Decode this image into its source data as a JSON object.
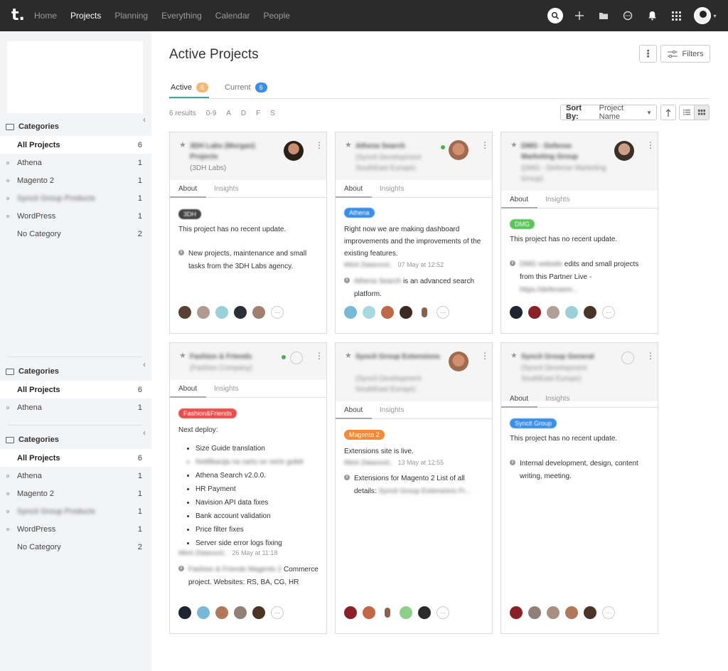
{
  "nav": {
    "logo": "t.",
    "items": [
      "Home",
      "Projects",
      "Planning",
      "Everything",
      "Calendar",
      "People"
    ],
    "active_index": 1
  },
  "sidebar": {
    "groups": [
      {
        "title": "Categories",
        "items": [
          {
            "label": "All Projects",
            "count": "6",
            "active": true
          },
          {
            "label": "Athena",
            "count": "1"
          },
          {
            "label": "Magento 2",
            "count": "1"
          },
          {
            "label": "Syncit Group Products",
            "count": "1",
            "blurred": true
          },
          {
            "label": "WordPress",
            "count": "1"
          },
          {
            "label": "No Category",
            "count": "2"
          }
        ]
      },
      {
        "title": "Categories",
        "items": [
          {
            "label": "All Projects",
            "count": "6",
            "active": true
          },
          {
            "label": "Athena",
            "count": "1"
          }
        ]
      },
      {
        "title": "Categories",
        "items": [
          {
            "label": "All Projects",
            "count": "6",
            "active": true
          },
          {
            "label": "Athena",
            "count": "1"
          },
          {
            "label": "Magento 2",
            "count": "1"
          },
          {
            "label": "Syncit Group Products",
            "count": "1",
            "blurred": true
          },
          {
            "label": "WordPress",
            "count": "1"
          },
          {
            "label": "No Category",
            "count": "2"
          }
        ]
      }
    ]
  },
  "header": {
    "title": "Active Projects",
    "filters_label": "Filters",
    "tabs": [
      {
        "label": "Active",
        "count": "6",
        "color": "#f5b87a"
      },
      {
        "label": "Current",
        "count": "6",
        "color": "#3a8ee6"
      }
    ],
    "results": "6 results",
    "letters": [
      "0-9",
      "A",
      "D",
      "F",
      "S"
    ],
    "sort_label": "Sort By:",
    "sort_value": "Project Name"
  },
  "cards": {
    "c1": {
      "title": "3DH Labs (Morgan) Projects",
      "subtitle": "(3DH Labs)",
      "tab_about": "About",
      "tab_insights": "Insights",
      "tag": "3DH",
      "tag_color": "#444444",
      "update": "This project has no recent update.",
      "info": "New projects, maintenance and small tasks from the 3DH Labs agency."
    },
    "c2": {
      "title": "Athena Search",
      "subtitle": "(Syncit Development SouthEast Europe)",
      "tab_about": "About",
      "tab_insights": "Insights",
      "tag": "Athena",
      "tag_color": "#3a8ee6",
      "update": "Right now we are making dashboard improvements and the improvements of the existing features.",
      "meta_author": "Miloš Zlatanović,",
      "meta_date": "07 May at 12:52",
      "info_blur": "Athena Search",
      "info": "is an advanced search platform."
    },
    "c3": {
      "title": "DMG - Defense Marketing Group",
      "subtitle": "(DMG - Defense Marketing Group)",
      "tab_about": "About",
      "tab_insights": "Insights",
      "tag": "DMG",
      "tag_color": "#5cc45c",
      "update": "This project has no recent update.",
      "info_blur": "DMG website",
      "info": "edits and small projects from this Partner Live -",
      "info_tail": "https://defensem..."
    },
    "c4": {
      "title": "Fashion & Friends",
      "subtitle": "(Fashion Company)",
      "tab_about": "About",
      "tab_insights": "Insights",
      "tag": "Fashion&Friends",
      "tag_color": "#e84c4c",
      "update": "Next deploy:",
      "list": [
        "Size Guide translation",
        "Notifikacija na cartu se neće gubiti",
        "Athena Search v2.0.0.",
        "HR Payment",
        "Navision API data fixes",
        "Bank account validation",
        "Price filter fixes",
        "Server side error logs fixing"
      ],
      "meta_author": "Miloš Zlatanović,",
      "meta_date": "26 May at 11:18",
      "info_blur": "Fashion & Friends Magento 2",
      "info": "Commerce project. Websites: RS, BA, CG, HR"
    },
    "c5": {
      "title": "Syncit Group Extensions",
      "subtitle": "(Syncit Development SouthEast Europe)",
      "tab_about": "About",
      "tab_insights": "Insights",
      "tag": "Magento 2",
      "tag_color": "#f08a3c",
      "update": "Extensions site is live.",
      "meta_author": "Miloš Zlatanović,",
      "meta_date": "13 May at 12:55",
      "info": "Extensions for Magento 2 List of all details:",
      "info_blur": "Syncit Group Extensions Fr..."
    },
    "c6": {
      "title": "Syncit Group General",
      "subtitle": "(Syncit Development SouthEast Europe)",
      "tab_about": "About",
      "tab_insights": "Insights",
      "tag": "Syncit Group",
      "tag_color": "#3a8ee6",
      "update": "This project has no recent update.",
      "info": "Internal development, design, content writing, meeting."
    }
  },
  "avatar_more": "···"
}
